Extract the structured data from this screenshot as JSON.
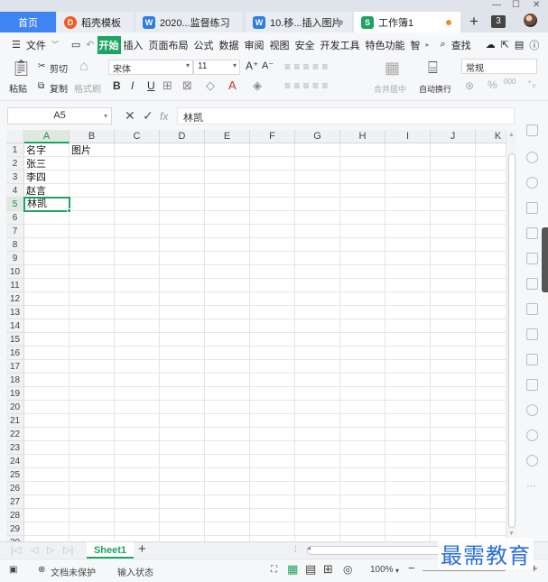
{
  "tabs": {
    "home": "首页",
    "t1": "稻壳模板",
    "t2": "2020...监督练习",
    "t3": "10.移...插入图片",
    "t4": "工作簿1",
    "count": "3"
  },
  "menu": {
    "file": "文件",
    "items": [
      "开始",
      "插入",
      "页面布局",
      "公式",
      "数据",
      "审阅",
      "视图",
      "安全",
      "开发工具",
      "特色功能",
      "智"
    ],
    "search": "查找"
  },
  "ribbon": {
    "paste": "粘贴",
    "cut": "剪切",
    "copy": "复制",
    "format_painter": "格式刷",
    "font_name": "宋体",
    "font_size": "11",
    "bold": "B",
    "italic": "I",
    "underline": "U",
    "merge_center": "合并居中",
    "wrap_text": "自动换行",
    "number_format": "常规",
    "percent": "%",
    "decimals": "000"
  },
  "formula_bar": {
    "cell_ref": "A5",
    "fx": "fx",
    "content": "林凯"
  },
  "grid": {
    "columns": [
      "A",
      "B",
      "C",
      "D",
      "E",
      "F",
      "G",
      "H",
      "I",
      "J",
      "K"
    ],
    "rows": [
      "1",
      "2",
      "3",
      "4",
      "5",
      "6",
      "7",
      "8",
      "9",
      "10",
      "11",
      "12",
      "13",
      "14",
      "15",
      "16",
      "17",
      "18",
      "19",
      "20",
      "21",
      "22",
      "23",
      "24",
      "25",
      "26",
      "27",
      "28",
      "29",
      "30"
    ],
    "cells": {
      "A1": "名字",
      "B1": "图片",
      "A2": "张三",
      "A3": "李四",
      "A4": "赵言",
      "A5": "林凯"
    },
    "selected_cell": "A5"
  },
  "sheet_tabs": {
    "active": "Sheet1",
    "add": "+"
  },
  "status": {
    "doc_protect": "文档未保护",
    "input_state": "输入状态",
    "zoom": "100%"
  },
  "watermark": "最需教育",
  "colors": {
    "accent": "#1da462",
    "home_tab": "#3e84f2",
    "watermark": "#2a6fd6"
  }
}
